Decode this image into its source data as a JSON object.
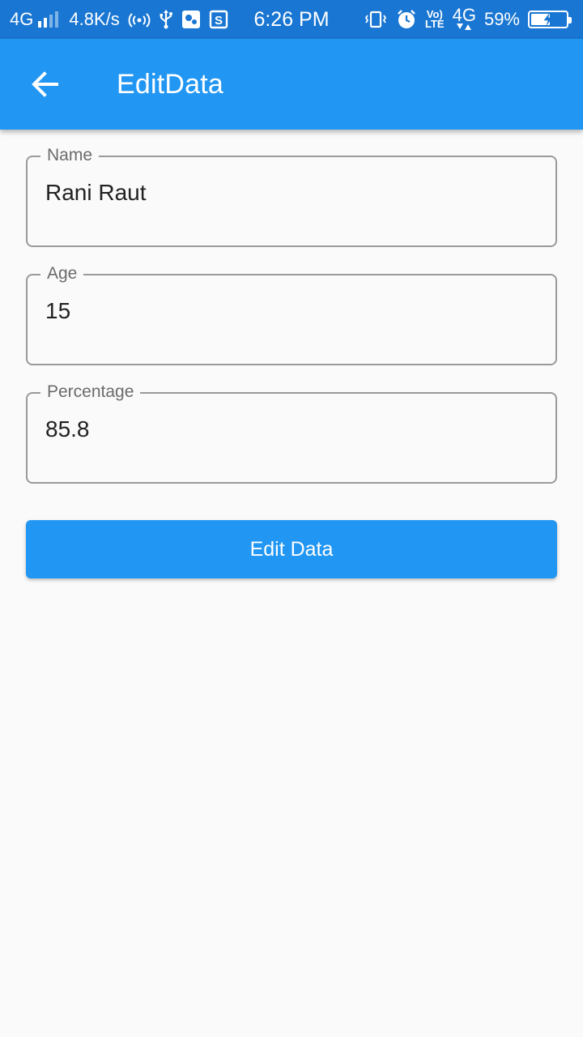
{
  "status_bar": {
    "network_type": "4G",
    "data_speed": "4.8K/s",
    "time": "6:26 PM",
    "volte_top": "Vo)",
    "volte_bottom": "LTE",
    "network_type_right": "4G",
    "battery_percent": "59%",
    "battery_level": 0.59,
    "icons": [
      "signal-bars-icon",
      "hotspot-icon",
      "usb-icon",
      "app-notification-icon",
      "s-app-icon",
      "vibrate-icon",
      "alarm-icon",
      "volte-icon",
      "battery-charging-icon"
    ]
  },
  "app_bar": {
    "title": "EditData",
    "back_icon": "arrow-back-icon"
  },
  "form": {
    "name": {
      "label": "Name",
      "value": "Rani Raut"
    },
    "age": {
      "label": "Age",
      "value": "15"
    },
    "percentage": {
      "label": "Percentage",
      "value": "85.8"
    }
  },
  "submit_button": {
    "label": "Edit Data"
  },
  "colors": {
    "status_bar": "#1976d2",
    "primary": "#2196f3",
    "background": "#fafafa",
    "field_border": "#9a9a9a"
  }
}
